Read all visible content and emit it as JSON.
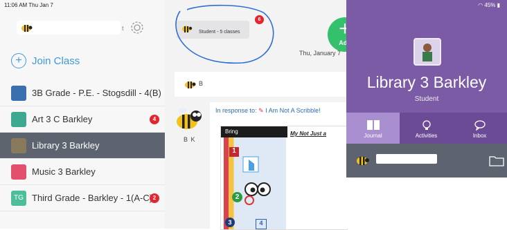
{
  "status_bar": {
    "time": "11:06 AM  Thu Jan 7",
    "battery": "45%"
  },
  "sidebar": {
    "account_suffix": "t",
    "join_label": "Join Class",
    "classes": [
      {
        "label": "3B Grade - P.E. - Stogsdill - 4(B)",
        "icon_color": "#3a6fb0",
        "icon_name": "basketball-icon",
        "icon_text": ""
      },
      {
        "label": "Art 3 C Barkley",
        "icon_color": "#3fa890",
        "icon_name": "art-icon",
        "icon_text": "",
        "badge": "4"
      },
      {
        "label": "Library 3 Barkley",
        "icon_color": "#8a7a5c",
        "icon_name": "library-icon",
        "icon_text": "",
        "active": true
      },
      {
        "label": "Music 3 Barkley",
        "icon_color": "#e3506d",
        "icon_name": "saxophone-icon",
        "icon_text": ""
      },
      {
        "label": "Third Grade - Barkley - 1(A-C)",
        "icon_color": "#4cbf9a",
        "icon_name": "tg-icon",
        "icon_text": "TG",
        "badge": "2"
      }
    ]
  },
  "feed": {
    "student_classes": "Student - 5 classes",
    "notification_count": "6",
    "add_label": "Add",
    "date": "Thu, January 7",
    "post_initial": "B",
    "response_prefix": "In response to:",
    "response_title": "I Am Not A Scribble!",
    "author_initials": "B K",
    "artwork": {
      "header": "Bring",
      "title": "My Not Just a",
      "steps": [
        "1",
        "2",
        "3"
      ],
      "step4": "4"
    }
  },
  "right_panel": {
    "title": "Library 3 Barkley",
    "subtitle": "Student",
    "tabs": [
      {
        "label": "Journal",
        "icon_name": "journal-icon",
        "active": true
      },
      {
        "label": "Activities",
        "icon_name": "lightbulb-icon"
      },
      {
        "label": "Inbox",
        "icon_name": "inbox-icon"
      }
    ],
    "colors": {
      "header": "#7b5aa6",
      "tabs": "#6c4b96",
      "active_tab": "#a98fcf"
    }
  }
}
